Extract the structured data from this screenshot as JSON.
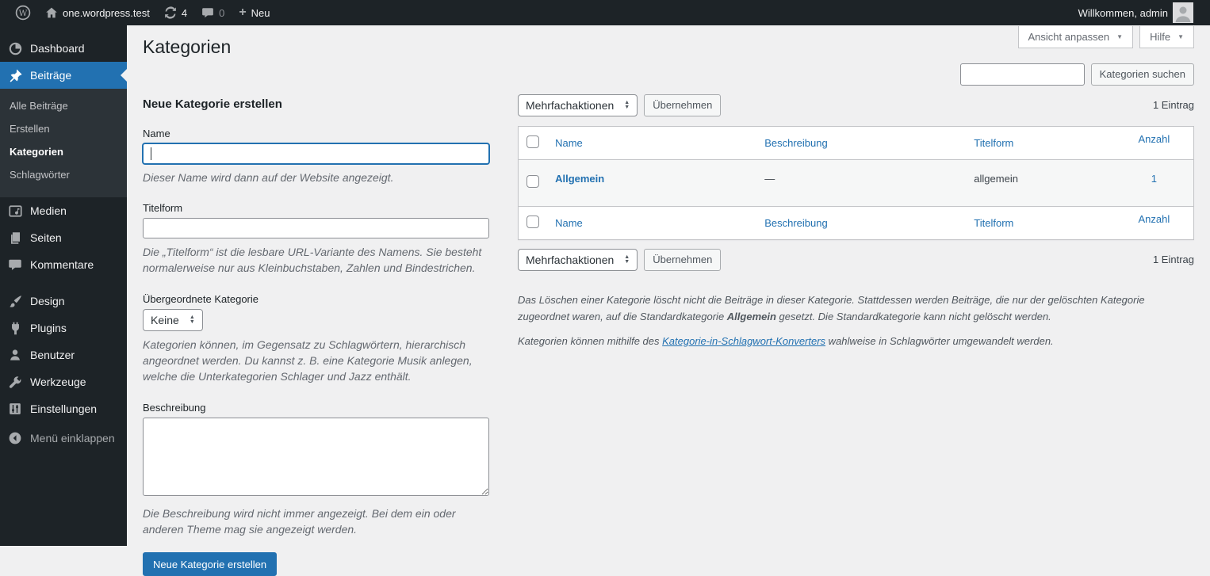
{
  "colors": {
    "accent": "#2271b1",
    "admin_dark": "#1d2327",
    "submenu_bg": "#2c3338",
    "content_bg": "#f0f0f1",
    "link_blue": "#2271b1"
  },
  "admin_bar": {
    "site_name": "one.wordpress.test",
    "update_count": "4",
    "comment_count": "0",
    "new_label": "Neu",
    "greeting": "Willkommen, admin"
  },
  "sidebar": {
    "items": [
      {
        "label": "Dashboard",
        "icon": "dashboard-icon"
      },
      {
        "label": "Beiträge",
        "icon": "pushpin-icon",
        "active": true
      },
      {
        "label": "Medien",
        "icon": "media-icon"
      },
      {
        "label": "Seiten",
        "icon": "pages-icon"
      },
      {
        "label": "Kommentare",
        "icon": "comment-icon"
      },
      {
        "label": "Design",
        "icon": "brush-icon"
      },
      {
        "label": "Plugins",
        "icon": "plug-icon"
      },
      {
        "label": "Benutzer",
        "icon": "user-icon"
      },
      {
        "label": "Werkzeuge",
        "icon": "wrench-icon"
      },
      {
        "label": "Einstellungen",
        "icon": "sliders-icon"
      },
      {
        "label": "Menü einklappen",
        "icon": "collapse-arrow-icon"
      }
    ],
    "submenu": [
      {
        "label": "Alle Beiträge"
      },
      {
        "label": "Erstellen"
      },
      {
        "label": "Kategorien",
        "current": true
      },
      {
        "label": "Schlagwörter"
      }
    ]
  },
  "page": {
    "title": "Kategorien"
  },
  "screen_meta": {
    "screen_options": "Ansicht anpassen",
    "help": "Hilfe"
  },
  "search": {
    "value": "",
    "button_label": "Kategorien suchen"
  },
  "tablenav": {
    "bulk_action_selected": "Mehrfachaktionen",
    "apply_label": "Übernehmen",
    "count_text": "1 Eintrag"
  },
  "form": {
    "title": "Neue Kategorie erstellen",
    "name": {
      "label": "Name",
      "value": "",
      "help": "Dieser Name wird dann auf der Website angezeigt."
    },
    "slug": {
      "label": "Titelform",
      "value": "",
      "help": "Die „Titelform“ ist die lesbare URL-Variante des Namens. Sie besteht normalerweise nur aus Kleinbuchstaben, Zahlen und Bindestrichen."
    },
    "parent": {
      "label": "Übergeordnete Kategorie",
      "selected": "Keine",
      "help": "Kategorien können, im Gegensatz zu Schlagwörtern, hierarchisch angeordnet werden. Du kannst z. B. eine Kategorie Musik anlegen, welche die Unterkategorien Schlager und Jazz enthält."
    },
    "description": {
      "label": "Beschreibung",
      "value": "",
      "help": "Die Beschreibung wird nicht immer angezeigt. Bei dem ein oder anderen Theme mag sie angezeigt werden."
    },
    "submit_label": "Neue Kategorie erstellen"
  },
  "table": {
    "columns": {
      "name": "Name",
      "description": "Beschreibung",
      "slug": "Titelform",
      "count": "Anzahl"
    },
    "rows": [
      {
        "name": "Allgemein",
        "description": "—",
        "slug": "allgemein",
        "count": "1"
      }
    ]
  },
  "notes": {
    "p1_before": "Das Löschen einer Kategorie löscht nicht die Beiträge in dieser Kategorie. Stattdessen werden Beiträge, die nur der gelöschten Kategorie zugeordnet waren, auf die Standardkategorie ",
    "p1_bold": "Allgemein",
    "p1_after": " gesetzt. Die Standardkategorie kann nicht gelöscht werden.",
    "p2_before": "Kategorien können mithilfe des ",
    "p2_link": "Kategorie-in-Schlagwort-Konverters",
    "p2_after": " wahlweise in Schlagwörter umgewandelt werden."
  }
}
